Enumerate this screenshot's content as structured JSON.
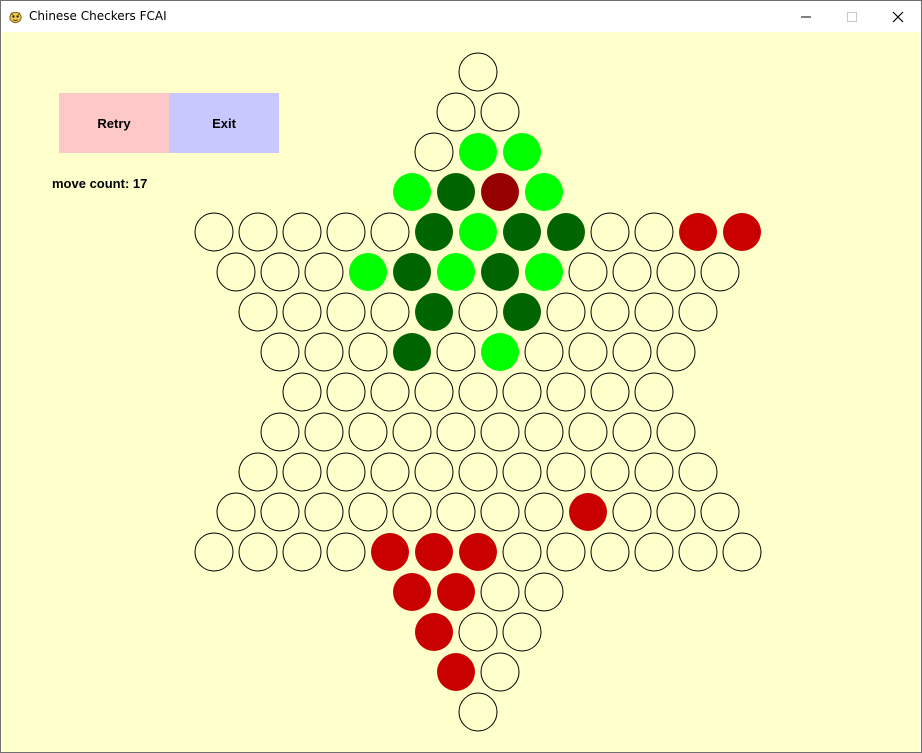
{
  "window": {
    "title": "Chinese Checkers FCAI",
    "controls": [
      "minimize-icon",
      "maximize-icon",
      "close-icon"
    ]
  },
  "buttons": {
    "retry_label": "Retry",
    "exit_label": "Exit",
    "retry_color": "#ffc8c8",
    "exit_color": "#c8c8ff"
  },
  "status": {
    "move_count_label": "move count:",
    "move_count_value": "17"
  },
  "colors": {
    "background": "#ffffcc",
    "empty": "#ffffcc",
    "light_green": "#00ff00",
    "dark_green": "#006400",
    "red": "#c80000",
    "selected_red": "#960000"
  },
  "board": {
    "legend": {
      ".": "empty",
      "L": "light_green",
      "D": "dark_green",
      "R": "red",
      "S": "selected_red"
    },
    "rows": [
      ".",
      "..",
      ".LL",
      "LDSL",
      ".....DLDD..RR",
      "...LDLDL....",
      "....D.D....",
      "...D.L....",
      ".........",
      "..........",
      "...........",
      "........R...",
      "....RRR......",
      "RR..",
      "R..",
      "R.",
      "."
    ]
  }
}
